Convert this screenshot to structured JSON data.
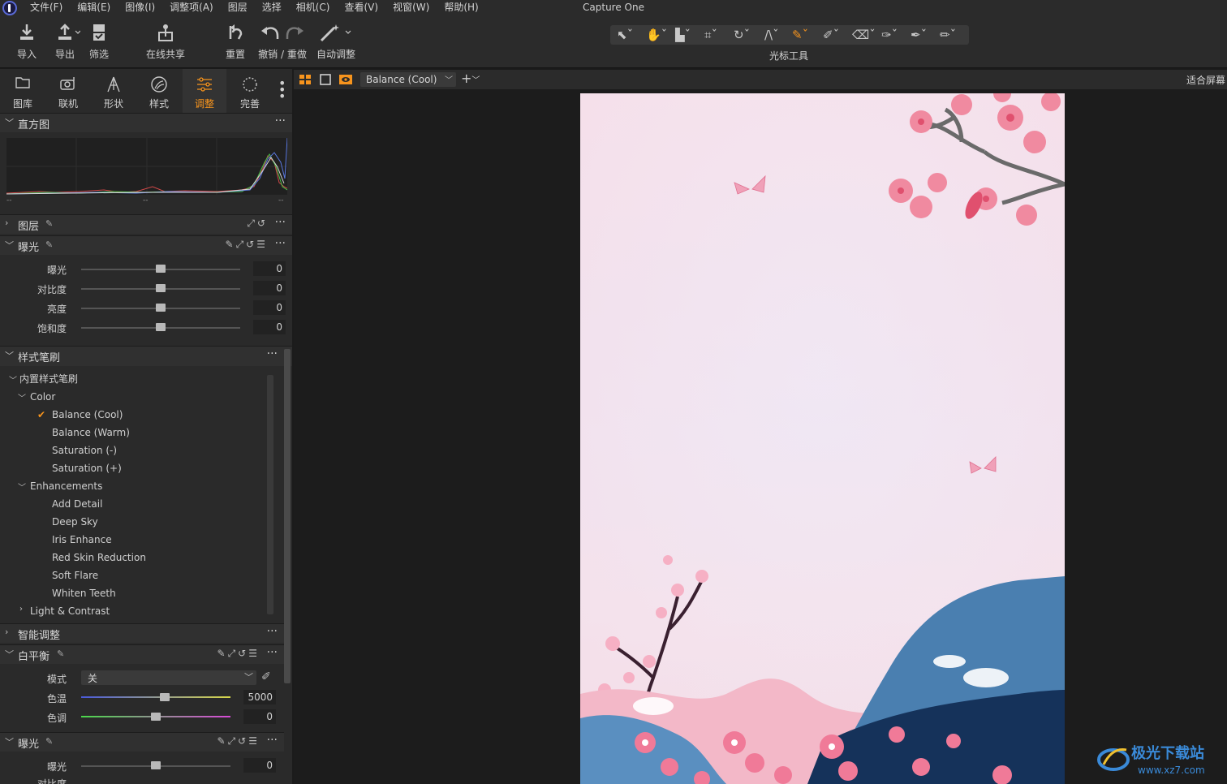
{
  "app": {
    "title": "Capture One"
  },
  "menu": [
    "文件(F)",
    "编辑(E)",
    "图像(I)",
    "调整项(A)",
    "图层",
    "选择",
    "相机(C)",
    "查看(V)",
    "视窗(W)",
    "帮助(H)"
  ],
  "toolbar": {
    "import": "导入",
    "export": "导出",
    "filter": "筛选",
    "share": "在线共享",
    "reset": "重置",
    "undo_redo": "撤销 / 重做",
    "auto_adjust": "自动调整",
    "cursor_tools": "光标工具"
  },
  "tool_tabs": [
    {
      "label": "图库",
      "icon": "folder-icon"
    },
    {
      "label": "联机",
      "icon": "camera-icon"
    },
    {
      "label": "形状",
      "icon": "aperture-icon"
    },
    {
      "label": "样式",
      "icon": "style-icon"
    },
    {
      "label": "调整",
      "icon": "sliders-icon",
      "active": true
    },
    {
      "label": "完善",
      "icon": "refine-icon"
    }
  ],
  "histogram": {
    "title": "直方图",
    "left_axis": "--",
    "mid_axis": "--",
    "right_axis": "--"
  },
  "layers": {
    "title": "图层"
  },
  "exposure": {
    "title": "曝光",
    "sliders": [
      {
        "label": "曝光",
        "value": "0"
      },
      {
        "label": "对比度",
        "value": "0"
      },
      {
        "label": "亮度",
        "value": "0"
      },
      {
        "label": "饱和度",
        "value": "0"
      }
    ]
  },
  "style_brush": {
    "title": "样式笔刷",
    "builtin": "内置样式笔刷",
    "color_group": "Color",
    "color_items": [
      "Balance (Cool)",
      "Balance (Warm)",
      "Saturation (-)",
      "Saturation (+)"
    ],
    "enhancements_group": "Enhancements",
    "enhancement_items": [
      "Add Detail",
      "Deep Sky",
      "Iris Enhance",
      "Red Skin Reduction",
      "Soft Flare",
      "Whiten Teeth"
    ],
    "light_group": "Light & Contrast",
    "selected": "Balance (Cool)"
  },
  "smart_adjust": {
    "title": "智能调整"
  },
  "white_balance": {
    "title": "白平衡",
    "mode_label": "模式",
    "mode_value": "关",
    "temp_label": "色温",
    "temp_value": "5000",
    "tint_label": "色调",
    "tint_value": "0"
  },
  "exposure2": {
    "title": "曝光",
    "slider_label": "曝光",
    "slider_value": "0",
    "partial_label": "对比度"
  },
  "viewer": {
    "style_select": "Balance (Cool)",
    "fit_label": "适合屏幕"
  },
  "watermark": {
    "text": "极光下载站",
    "url": "www.xz7.com"
  },
  "colors": {
    "accent": "#f7941d",
    "panel": "#2a2a2a",
    "bg": "#1c1c1c"
  }
}
